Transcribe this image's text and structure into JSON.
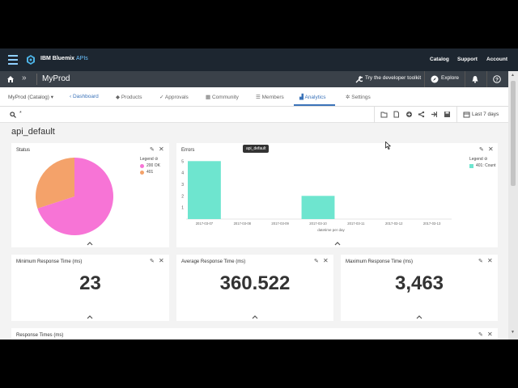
{
  "topbar": {
    "brand": "IBM Bluemix",
    "brand_suffix": "APIs",
    "nav": [
      "Catalog",
      "Support",
      "Account"
    ]
  },
  "secbar": {
    "org": "MyProd",
    "dev_toolkit": "Try the developer toolkit",
    "explore": "Explore"
  },
  "tabs": {
    "catalog": "MyProd  (Catalog)",
    "items": [
      "Dashboard",
      "Products",
      "Approvals",
      "Community",
      "Members",
      "Analytics",
      "Settings"
    ],
    "active": "Analytics"
  },
  "search": {
    "value": "*",
    "range": "Last 7 days"
  },
  "api_title": "api_default",
  "tooltip": "api_default",
  "status_card": {
    "title": "Status",
    "legend_title": "Legend",
    "legend": [
      "200 OK",
      "401"
    ],
    "colors": [
      "#f774d6",
      "#f4a26a"
    ]
  },
  "errors_card": {
    "title": "Errors",
    "legend_title": "Legend",
    "legend": [
      "401: Count"
    ],
    "color": "#6ee5cf"
  },
  "chart_data": [
    {
      "type": "pie",
      "title": "Status",
      "labels": [
        "200 OK",
        "401"
      ],
      "values": [
        70,
        30
      ],
      "colors": [
        "#f774d6",
        "#f4a26a"
      ],
      "legend": "top-right"
    },
    {
      "type": "bar",
      "title": "Errors",
      "xlabel": "datetime per day",
      "ylabel": "",
      "categories": [
        "2017-03-07",
        "2017-03-08",
        "2017-03-09",
        "2017-03-10",
        "2017-03-11",
        "2017-03-12",
        "2017-03-13"
      ],
      "series": [
        {
          "name": "401: Count",
          "values": [
            5,
            0,
            0,
            2,
            0,
            0,
            0
          ]
        }
      ],
      "yticks": [
        1,
        2,
        3,
        4,
        5
      ],
      "ylim": [
        0,
        5.3
      ],
      "legend": "top-right"
    }
  ],
  "metrics": [
    {
      "title": "Minimum Response Time (ms)",
      "value": "23"
    },
    {
      "title": "Average Response Time (ms)",
      "value": "360.522"
    },
    {
      "title": "Maximum Response Time (ms)",
      "value": "3,463"
    }
  ],
  "response_times_title": "Response Times (ms)"
}
